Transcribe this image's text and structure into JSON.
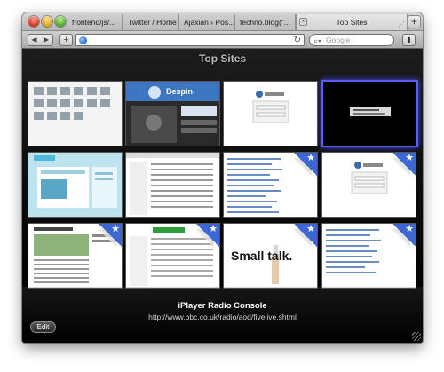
{
  "window": {
    "tabs": [
      {
        "label": "frontend/js/..."
      },
      {
        "label": "Twitter / Home"
      },
      {
        "label": "Ajaxian › Pos..."
      },
      {
        "label": "techno.blog(\"..."
      },
      {
        "label": "Top Sites",
        "active": true
      }
    ],
    "new_tab_icon": "plus-icon"
  },
  "toolbar": {
    "back_icon": "◀",
    "forward_icon": "▶",
    "add_bookmark_icon": "+",
    "address_value": "",
    "reload_icon": "↻",
    "search_placeholder": "Google",
    "bookmarks_icon": "▮"
  },
  "top_sites": {
    "title": "Top Sites",
    "tiles": [
      {
        "row": 1,
        "col": 1,
        "kind": "icon-grid"
      },
      {
        "row": 1,
        "col": 2,
        "kind": "bespin",
        "text": "Bespin"
      },
      {
        "row": 1,
        "col": 3,
        "kind": "wordpress-login"
      },
      {
        "row": 1,
        "col": 4,
        "kind": "dark-dialog",
        "selected": true
      },
      {
        "row": 2,
        "col": 1,
        "kind": "twitter-like"
      },
      {
        "row": 2,
        "col": 2,
        "kind": "list-page"
      },
      {
        "row": 2,
        "col": 3,
        "kind": "text-list",
        "starred": true
      },
      {
        "row": 2,
        "col": 4,
        "kind": "wordpress-login",
        "starred": true
      },
      {
        "row": 3,
        "col": 1,
        "kind": "blog",
        "starred": true
      },
      {
        "row": 3,
        "col": 2,
        "kind": "article",
        "starred": true
      },
      {
        "row": 3,
        "col": 3,
        "kind": "small-talk",
        "text": "Small talk.",
        "starred": true
      },
      {
        "row": 3,
        "col": 4,
        "kind": "text-list",
        "starred": true
      }
    ],
    "hover_site_name": "iPlayer Radio Console",
    "hover_site_url": "http://www.bbc.co.uk/radio/aod/fivelive.shtml",
    "edit_label": "Edit",
    "star_glyph": "★"
  }
}
